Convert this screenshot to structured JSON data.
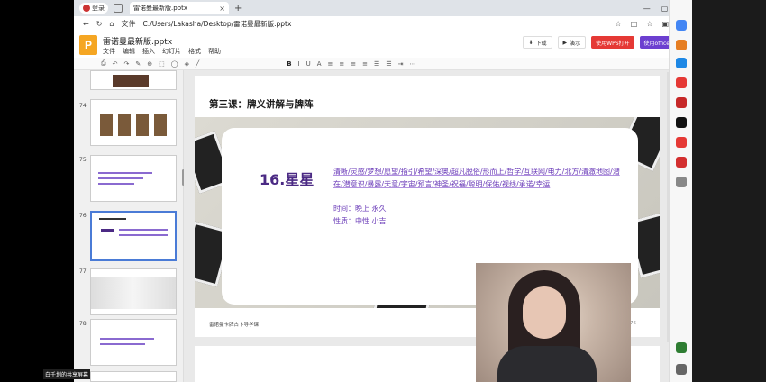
{
  "browser": {
    "profile_label": "登录",
    "tab_title": "雷诺曼最新版.pptx",
    "url_prefix": "文件",
    "url": "C:/Users/Lakasha/Desktop/雷诺曼最新版.pptx"
  },
  "app": {
    "logo": "P",
    "doc_name": "雷诺曼最新版.pptx",
    "menus": [
      "文件",
      "编辑",
      "插入",
      "幻灯片",
      "格式",
      "帮助"
    ],
    "buttons": {
      "download": "下载",
      "present": "演示",
      "wps": "使用WPS打开",
      "office": "使用office打开"
    }
  },
  "toolbar": {
    "bold": "B",
    "italic": "I",
    "underline": "U",
    "color": "A"
  },
  "slides_panel": {
    "numbers": [
      "74",
      "75",
      "76",
      "77",
      "78"
    ],
    "selected": "76"
  },
  "slide": {
    "title": "第三课：牌义讲解与牌阵",
    "card_name": "16.星星",
    "keywords": "清晰/灵感/梦想/愿望/指引/希望/深奥/超凡脱俗/形而上/哲学/互联网/电力/北方/清澈地图/潜在/潜意识/暴露/天意/宇宙/预言/神圣/祝福/聪明/保佑/视线/承诺/幸运",
    "time": "时间：晚上 永久",
    "nature": "性质：中性 小吉",
    "footer": "雷诺曼卡牌占卜导学课",
    "page_number": "76"
  },
  "share_label": "白千划的共享屏幕",
  "colors": {
    "accent": "#6a3bb8",
    "title": "#4b2a84",
    "wps_red": "#e53935",
    "office_purple": "#6c3fd0"
  }
}
